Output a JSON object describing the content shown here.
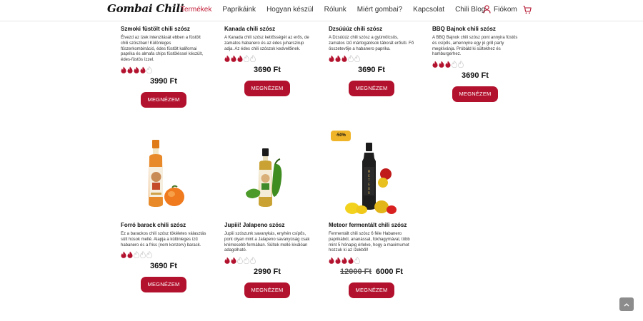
{
  "header": {
    "logo": "Gombai Chili",
    "nav": [
      "Termékek",
      "Paprikáink",
      "Hogyan készül",
      "Rólunk",
      "Miért gombai?",
      "Kapcsolat",
      "Chili Blog"
    ],
    "active_nav": "Termékek",
    "account_label": "Fiókom",
    "account_icon": "user-icon",
    "cart_icon": "cart-icon"
  },
  "colors": {
    "accent": "#b3122e",
    "badge": "#f0b429"
  },
  "button_label": "MEGNÉZEM",
  "products": [
    {
      "title": "Szmoki füstölt chili szósz",
      "desc": "Élvezd az ízek intenzitását ebben a füstölt chili szószban! Különleges fűszerkombináció, édes füstölt kalifornai paprika és almafa chips füstöléssel készült, édes-füstös ízzel.",
      "heat": 4,
      "price": "3990 Ft"
    },
    {
      "title": "Kanada chili szósz",
      "desc": "A Kanada chili szósz kettősségét az erős, de zamatos habanero és az édes juharszirup adja. Az édes chili szószok kedvelőinek.",
      "heat": 3,
      "price": "3690 Ft"
    },
    {
      "title": "Dzsúúúz chili szósz",
      "desc": "A Dzsúúúz chili szósz a gyümölcsös, zamatos ízű mártogatósok táborát erősíti. Fő összetevője a habanero paprika.",
      "heat": 3,
      "price": "3690 Ft"
    },
    {
      "title": "BBQ Bajnok chili szósz",
      "desc": "A BBQ Bajnok chili szósz pont annyira füstös és csípős, amennyire egy jó grill party megkívánja. Próbáld ki sültekhez és hamburgerhez.",
      "heat": 3,
      "price": "3690 Ft"
    },
    {
      "title": "Forró barack chili szósz",
      "desc": "Ez a barackos chili szósz tökéletes választás sült húsok mellé. Alapja a különleges ízű habanero és a friss (nem konzerv) barack.",
      "heat": 2,
      "price": "3690 Ft"
    },
    {
      "title": "Jupiii! Jalapeno szósz",
      "desc": "Jupiii szószunk savanykás, enyhén csípős, pont olyan mint a Jalapeno savanyúság csak krémesebb formában. Sültek mellé kiválóan adagolható.",
      "heat": 2,
      "price": "2990 Ft"
    },
    {
      "title": "Meteor fermentált chili szósz",
      "desc": "Fermentált chili szósz 6 féle Habanero paprikából, ananással, fokhagymával, több mint 5 hónapig érlelve, hogy a maximumot hozzuk ki az ízekből!",
      "heat": 4,
      "old_price": "12000 Ft",
      "price": "6000 Ft",
      "badge": "-50%"
    }
  ]
}
